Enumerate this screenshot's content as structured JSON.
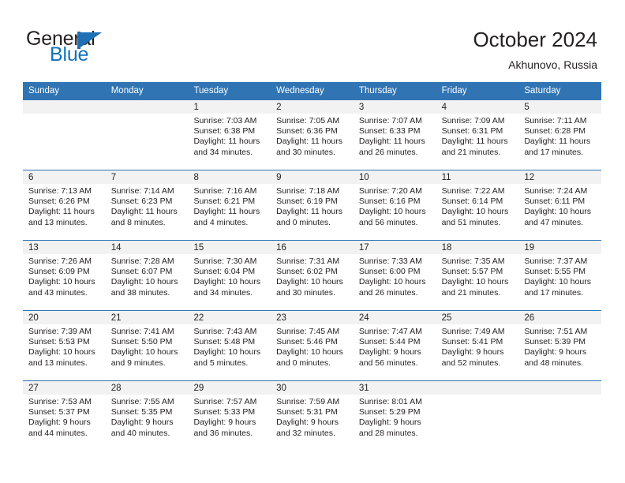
{
  "brand": {
    "name_part1": "General",
    "name_part2": "Blue",
    "flag_icon": "triangle-flag-icon",
    "accent_color": "#1073be"
  },
  "header": {
    "title": "October 2024",
    "location": "Akhunovo, Russia"
  },
  "theme": {
    "header_blue": "#3074b4",
    "daynum_band": "#f2f2f2",
    "text": "#231f20"
  },
  "calendar": {
    "weekday_headers": [
      "Sunday",
      "Monday",
      "Tuesday",
      "Wednesday",
      "Thursday",
      "Friday",
      "Saturday"
    ],
    "weeks": [
      [
        {
          "day": ""
        },
        {
          "day": ""
        },
        {
          "day": "1",
          "sunrise": "Sunrise: 7:03 AM",
          "sunset": "Sunset: 6:38 PM",
          "daylight1": "Daylight: 11 hours",
          "daylight2": "and 34 minutes."
        },
        {
          "day": "2",
          "sunrise": "Sunrise: 7:05 AM",
          "sunset": "Sunset: 6:36 PM",
          "daylight1": "Daylight: 11 hours",
          "daylight2": "and 30 minutes."
        },
        {
          "day": "3",
          "sunrise": "Sunrise: 7:07 AM",
          "sunset": "Sunset: 6:33 PM",
          "daylight1": "Daylight: 11 hours",
          "daylight2": "and 26 minutes."
        },
        {
          "day": "4",
          "sunrise": "Sunrise: 7:09 AM",
          "sunset": "Sunset: 6:31 PM",
          "daylight1": "Daylight: 11 hours",
          "daylight2": "and 21 minutes."
        },
        {
          "day": "5",
          "sunrise": "Sunrise: 7:11 AM",
          "sunset": "Sunset: 6:28 PM",
          "daylight1": "Daylight: 11 hours",
          "daylight2": "and 17 minutes."
        }
      ],
      [
        {
          "day": "6",
          "sunrise": "Sunrise: 7:13 AM",
          "sunset": "Sunset: 6:26 PM",
          "daylight1": "Daylight: 11 hours",
          "daylight2": "and 13 minutes."
        },
        {
          "day": "7",
          "sunrise": "Sunrise: 7:14 AM",
          "sunset": "Sunset: 6:23 PM",
          "daylight1": "Daylight: 11 hours",
          "daylight2": "and 8 minutes."
        },
        {
          "day": "8",
          "sunrise": "Sunrise: 7:16 AM",
          "sunset": "Sunset: 6:21 PM",
          "daylight1": "Daylight: 11 hours",
          "daylight2": "and 4 minutes."
        },
        {
          "day": "9",
          "sunrise": "Sunrise: 7:18 AM",
          "sunset": "Sunset: 6:19 PM",
          "daylight1": "Daylight: 11 hours",
          "daylight2": "and 0 minutes."
        },
        {
          "day": "10",
          "sunrise": "Sunrise: 7:20 AM",
          "sunset": "Sunset: 6:16 PM",
          "daylight1": "Daylight: 10 hours",
          "daylight2": "and 56 minutes."
        },
        {
          "day": "11",
          "sunrise": "Sunrise: 7:22 AM",
          "sunset": "Sunset: 6:14 PM",
          "daylight1": "Daylight: 10 hours",
          "daylight2": "and 51 minutes."
        },
        {
          "day": "12",
          "sunrise": "Sunrise: 7:24 AM",
          "sunset": "Sunset: 6:11 PM",
          "daylight1": "Daylight: 10 hours",
          "daylight2": "and 47 minutes."
        }
      ],
      [
        {
          "day": "13",
          "sunrise": "Sunrise: 7:26 AM",
          "sunset": "Sunset: 6:09 PM",
          "daylight1": "Daylight: 10 hours",
          "daylight2": "and 43 minutes."
        },
        {
          "day": "14",
          "sunrise": "Sunrise: 7:28 AM",
          "sunset": "Sunset: 6:07 PM",
          "daylight1": "Daylight: 10 hours",
          "daylight2": "and 38 minutes."
        },
        {
          "day": "15",
          "sunrise": "Sunrise: 7:30 AM",
          "sunset": "Sunset: 6:04 PM",
          "daylight1": "Daylight: 10 hours",
          "daylight2": "and 34 minutes."
        },
        {
          "day": "16",
          "sunrise": "Sunrise: 7:31 AM",
          "sunset": "Sunset: 6:02 PM",
          "daylight1": "Daylight: 10 hours",
          "daylight2": "and 30 minutes."
        },
        {
          "day": "17",
          "sunrise": "Sunrise: 7:33 AM",
          "sunset": "Sunset: 6:00 PM",
          "daylight1": "Daylight: 10 hours",
          "daylight2": "and 26 minutes."
        },
        {
          "day": "18",
          "sunrise": "Sunrise: 7:35 AM",
          "sunset": "Sunset: 5:57 PM",
          "daylight1": "Daylight: 10 hours",
          "daylight2": "and 21 minutes."
        },
        {
          "day": "19",
          "sunrise": "Sunrise: 7:37 AM",
          "sunset": "Sunset: 5:55 PM",
          "daylight1": "Daylight: 10 hours",
          "daylight2": "and 17 minutes."
        }
      ],
      [
        {
          "day": "20",
          "sunrise": "Sunrise: 7:39 AM",
          "sunset": "Sunset: 5:53 PM",
          "daylight1": "Daylight: 10 hours",
          "daylight2": "and 13 minutes."
        },
        {
          "day": "21",
          "sunrise": "Sunrise: 7:41 AM",
          "sunset": "Sunset: 5:50 PM",
          "daylight1": "Daylight: 10 hours",
          "daylight2": "and 9 minutes."
        },
        {
          "day": "22",
          "sunrise": "Sunrise: 7:43 AM",
          "sunset": "Sunset: 5:48 PM",
          "daylight1": "Daylight: 10 hours",
          "daylight2": "and 5 minutes."
        },
        {
          "day": "23",
          "sunrise": "Sunrise: 7:45 AM",
          "sunset": "Sunset: 5:46 PM",
          "daylight1": "Daylight: 10 hours",
          "daylight2": "and 0 minutes."
        },
        {
          "day": "24",
          "sunrise": "Sunrise: 7:47 AM",
          "sunset": "Sunset: 5:44 PM",
          "daylight1": "Daylight: 9 hours",
          "daylight2": "and 56 minutes."
        },
        {
          "day": "25",
          "sunrise": "Sunrise: 7:49 AM",
          "sunset": "Sunset: 5:41 PM",
          "daylight1": "Daylight: 9 hours",
          "daylight2": "and 52 minutes."
        },
        {
          "day": "26",
          "sunrise": "Sunrise: 7:51 AM",
          "sunset": "Sunset: 5:39 PM",
          "daylight1": "Daylight: 9 hours",
          "daylight2": "and 48 minutes."
        }
      ],
      [
        {
          "day": "27",
          "sunrise": "Sunrise: 7:53 AM",
          "sunset": "Sunset: 5:37 PM",
          "daylight1": "Daylight: 9 hours",
          "daylight2": "and 44 minutes."
        },
        {
          "day": "28",
          "sunrise": "Sunrise: 7:55 AM",
          "sunset": "Sunset: 5:35 PM",
          "daylight1": "Daylight: 9 hours",
          "daylight2": "and 40 minutes."
        },
        {
          "day": "29",
          "sunrise": "Sunrise: 7:57 AM",
          "sunset": "Sunset: 5:33 PM",
          "daylight1": "Daylight: 9 hours",
          "daylight2": "and 36 minutes."
        },
        {
          "day": "30",
          "sunrise": "Sunrise: 7:59 AM",
          "sunset": "Sunset: 5:31 PM",
          "daylight1": "Daylight: 9 hours",
          "daylight2": "and 32 minutes."
        },
        {
          "day": "31",
          "sunrise": "Sunrise: 8:01 AM",
          "sunset": "Sunset: 5:29 PM",
          "daylight1": "Daylight: 9 hours",
          "daylight2": "and 28 minutes."
        },
        {
          "day": ""
        },
        {
          "day": ""
        }
      ]
    ]
  }
}
